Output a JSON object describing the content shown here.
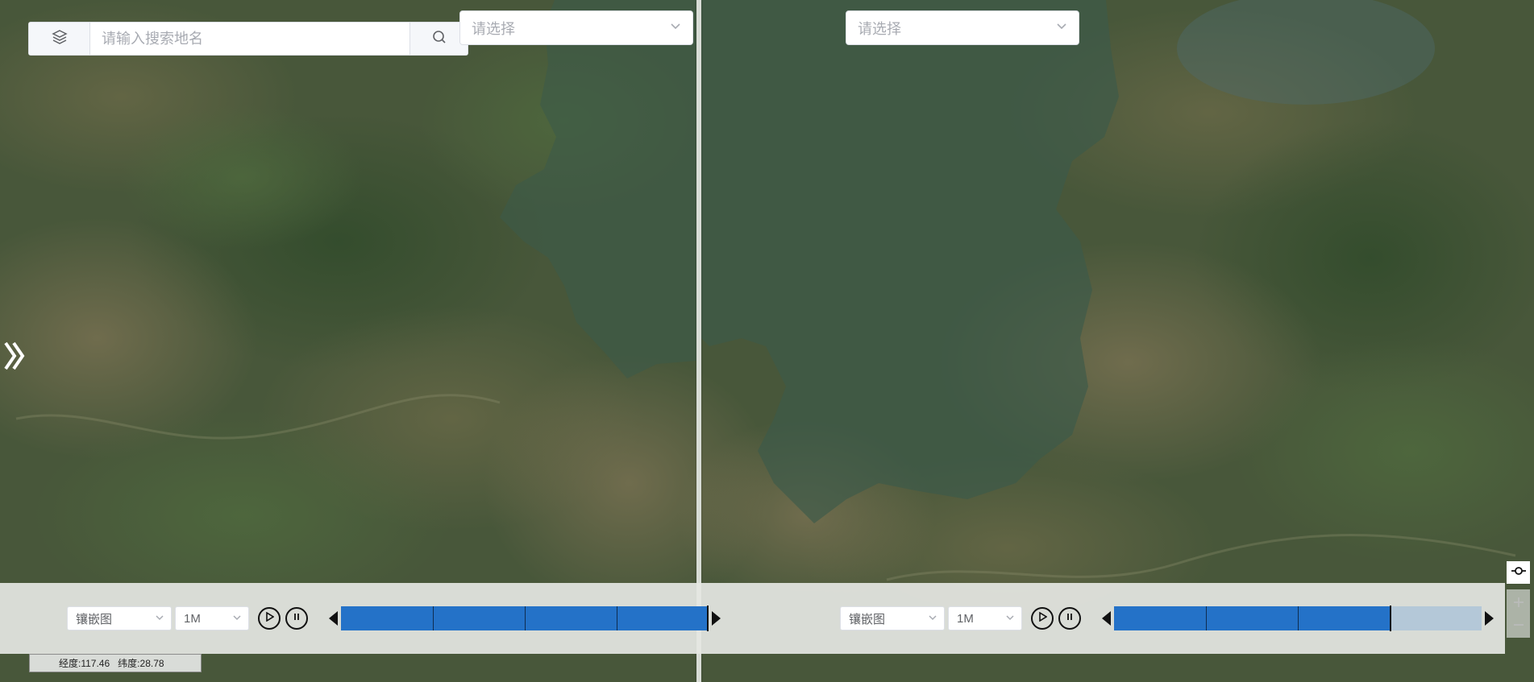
{
  "search": {
    "placeholder": "请输入搜索地名"
  },
  "left_select": {
    "placeholder": "请选择"
  },
  "right_select": {
    "placeholder": "请选择"
  },
  "left_timeline": {
    "layer_type": "镶嵌图",
    "resolution": "1M",
    "progress": 1.0,
    "segments": 4
  },
  "right_timeline": {
    "layer_type": "镶嵌图",
    "resolution": "1M",
    "progress": 0.75,
    "segments": 4
  },
  "coords": {
    "lon_label": "经度:",
    "lon": "117.46",
    "lat_label": "纬度:",
    "lat": "28.78"
  },
  "colors": {
    "track_fill": "#2472c8",
    "track_empty": "#b4c8d8",
    "timeline_bg": "#e4e6e2",
    "overlay_region": "#3c5a4a"
  },
  "icons": {
    "layers": "layers-icon",
    "search": "search-icon",
    "dropdown": "chevron-down-icon",
    "expand": "double-chevron-right-icon",
    "play": "play-icon",
    "pause": "pause-icon",
    "prev": "triangle-left-icon",
    "next": "triangle-right-icon",
    "swipe": "swipe-compare-icon",
    "zoom_in": "plus-icon",
    "zoom_out": "minus-icon"
  }
}
